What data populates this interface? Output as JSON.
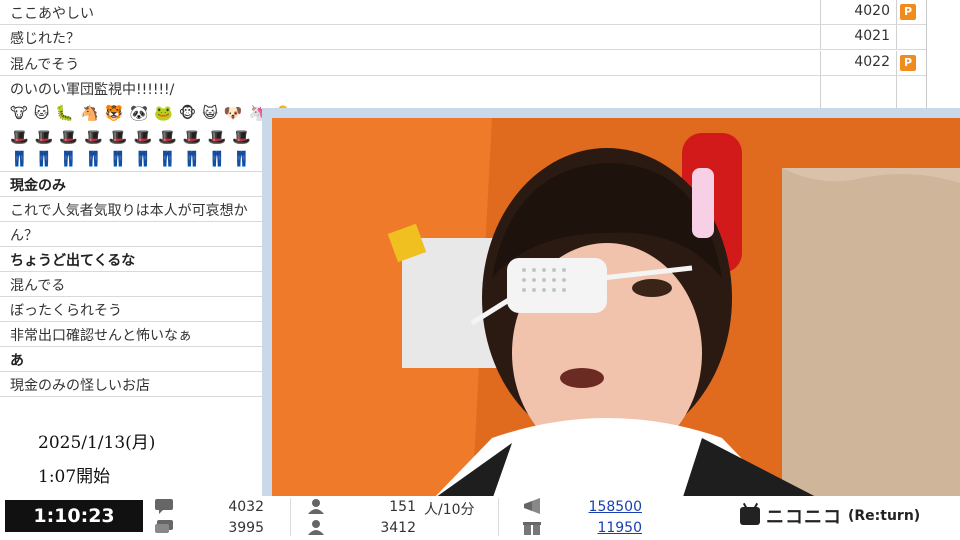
{
  "comments": [
    {
      "text": "ここあやしい",
      "bold": false,
      "number": "4020",
      "premium": true
    },
    {
      "text": "感じれた？",
      "bold": false,
      "number": "4021",
      "premium": false
    },
    {
      "text": "混んでそう",
      "bold": false,
      "number": "4022",
      "premium": true
    }
  ],
  "tall_comment": {
    "text": "のいのい軍団監視中!!!!!!/",
    "icon_rows": [
      [
        "🐮",
        "🐱",
        "🐛",
        "🐴",
        "🐯",
        "🐼",
        "🐸",
        "🐵",
        "😺",
        "🐶",
        "🦄",
        "🐣"
      ],
      [
        "🎩",
        "🎩",
        "🎩",
        "🎩",
        "🎩",
        "🎩",
        "🎩",
        "🎩",
        "🎩",
        "🎩"
      ],
      [
        "👖",
        "👖",
        "👖",
        "👖",
        "👖",
        "👖",
        "👖",
        "👖",
        "👖",
        "👖"
      ]
    ]
  },
  "comments_below": [
    {
      "text": "現金のみ",
      "bold": true
    },
    {
      "text": "これで人気者気取りは本人が可哀想か",
      "bold": false
    },
    {
      "text": "ん？",
      "bold": false
    },
    {
      "text": "ちょうど出てくるな",
      "bold": true
    },
    {
      "text": "混んでる",
      "bold": false
    },
    {
      "text": "ぼったくられそう",
      "bold": false
    },
    {
      "text": "非常出口確認せんと怖いなぁ",
      "bold": false
    },
    {
      "text": "あ",
      "bold": true
    },
    {
      "text": "現金のみの怪しいお店",
      "bold": false
    }
  ],
  "broadcast": {
    "date": "2025/1/13(月)",
    "start": "1:07開始"
  },
  "status_bar": {
    "elapsed": "1:10:23",
    "comments_total": "4032",
    "comments_2": "3995",
    "viewers_per_10min": "151",
    "viewers_unit": "人/10分",
    "visitors": "3412",
    "ad_points": "158500",
    "gift_points": "11950",
    "logo_text": "ニコニコ",
    "logo_sub": "(Re:turn)"
  },
  "colors": {
    "premium_badge": "#f08c1e",
    "link": "#1a3fb0",
    "timer_bg": "#111111"
  }
}
